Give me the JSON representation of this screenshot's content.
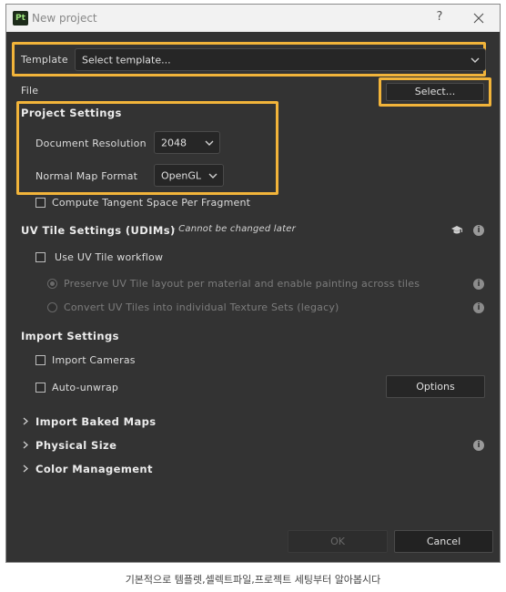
{
  "window": {
    "title": "New project",
    "app_icon_text": "Pt",
    "help_label": "?"
  },
  "template": {
    "label": "Template",
    "value": "Select template..."
  },
  "file": {
    "label": "File",
    "button_label": "Select..."
  },
  "project_settings": {
    "header": "Project Settings",
    "resolution_label": "Document Resolution",
    "resolution_value": "2048",
    "normal_map_label": "Normal Map Format",
    "normal_map_value": "OpenGL",
    "compute_tangent_label": "Compute Tangent Space Per Fragment",
    "compute_tangent_checked": false
  },
  "uv_tile": {
    "header": "UV Tile Settings (UDIMs)",
    "note": "- Cannot be changed later",
    "use_workflow_label": "Use UV Tile workflow",
    "use_workflow_checked": false,
    "option_preserve": "Preserve UV Tile layout per material and enable painting across tiles",
    "option_convert": "Convert UV Tiles into individual Texture Sets (legacy)"
  },
  "import_settings": {
    "header": "Import Settings",
    "import_cameras_label": "Import Cameras",
    "auto_unwrap_label": "Auto-unwrap",
    "options_button": "Options"
  },
  "collapsible_sections": {
    "baked_maps": "Import Baked Maps",
    "physical_size": "Physical Size",
    "color_management": "Color Management"
  },
  "footer": {
    "ok_label": "OK",
    "cancel_label": "Cancel"
  },
  "caption": "기본적으로 템플렛,셀렉트파일,프로젝트 세팅부터 알아봅시다",
  "colors": {
    "highlight": "#f2b43a",
    "dialog_bg": "#333333",
    "field_bg": "#262626"
  },
  "icons": {
    "info": "info-icon",
    "graduation": "graduation-cap-icon",
    "chevron": "chevron-down-icon",
    "expand": "chevron-right-icon"
  }
}
